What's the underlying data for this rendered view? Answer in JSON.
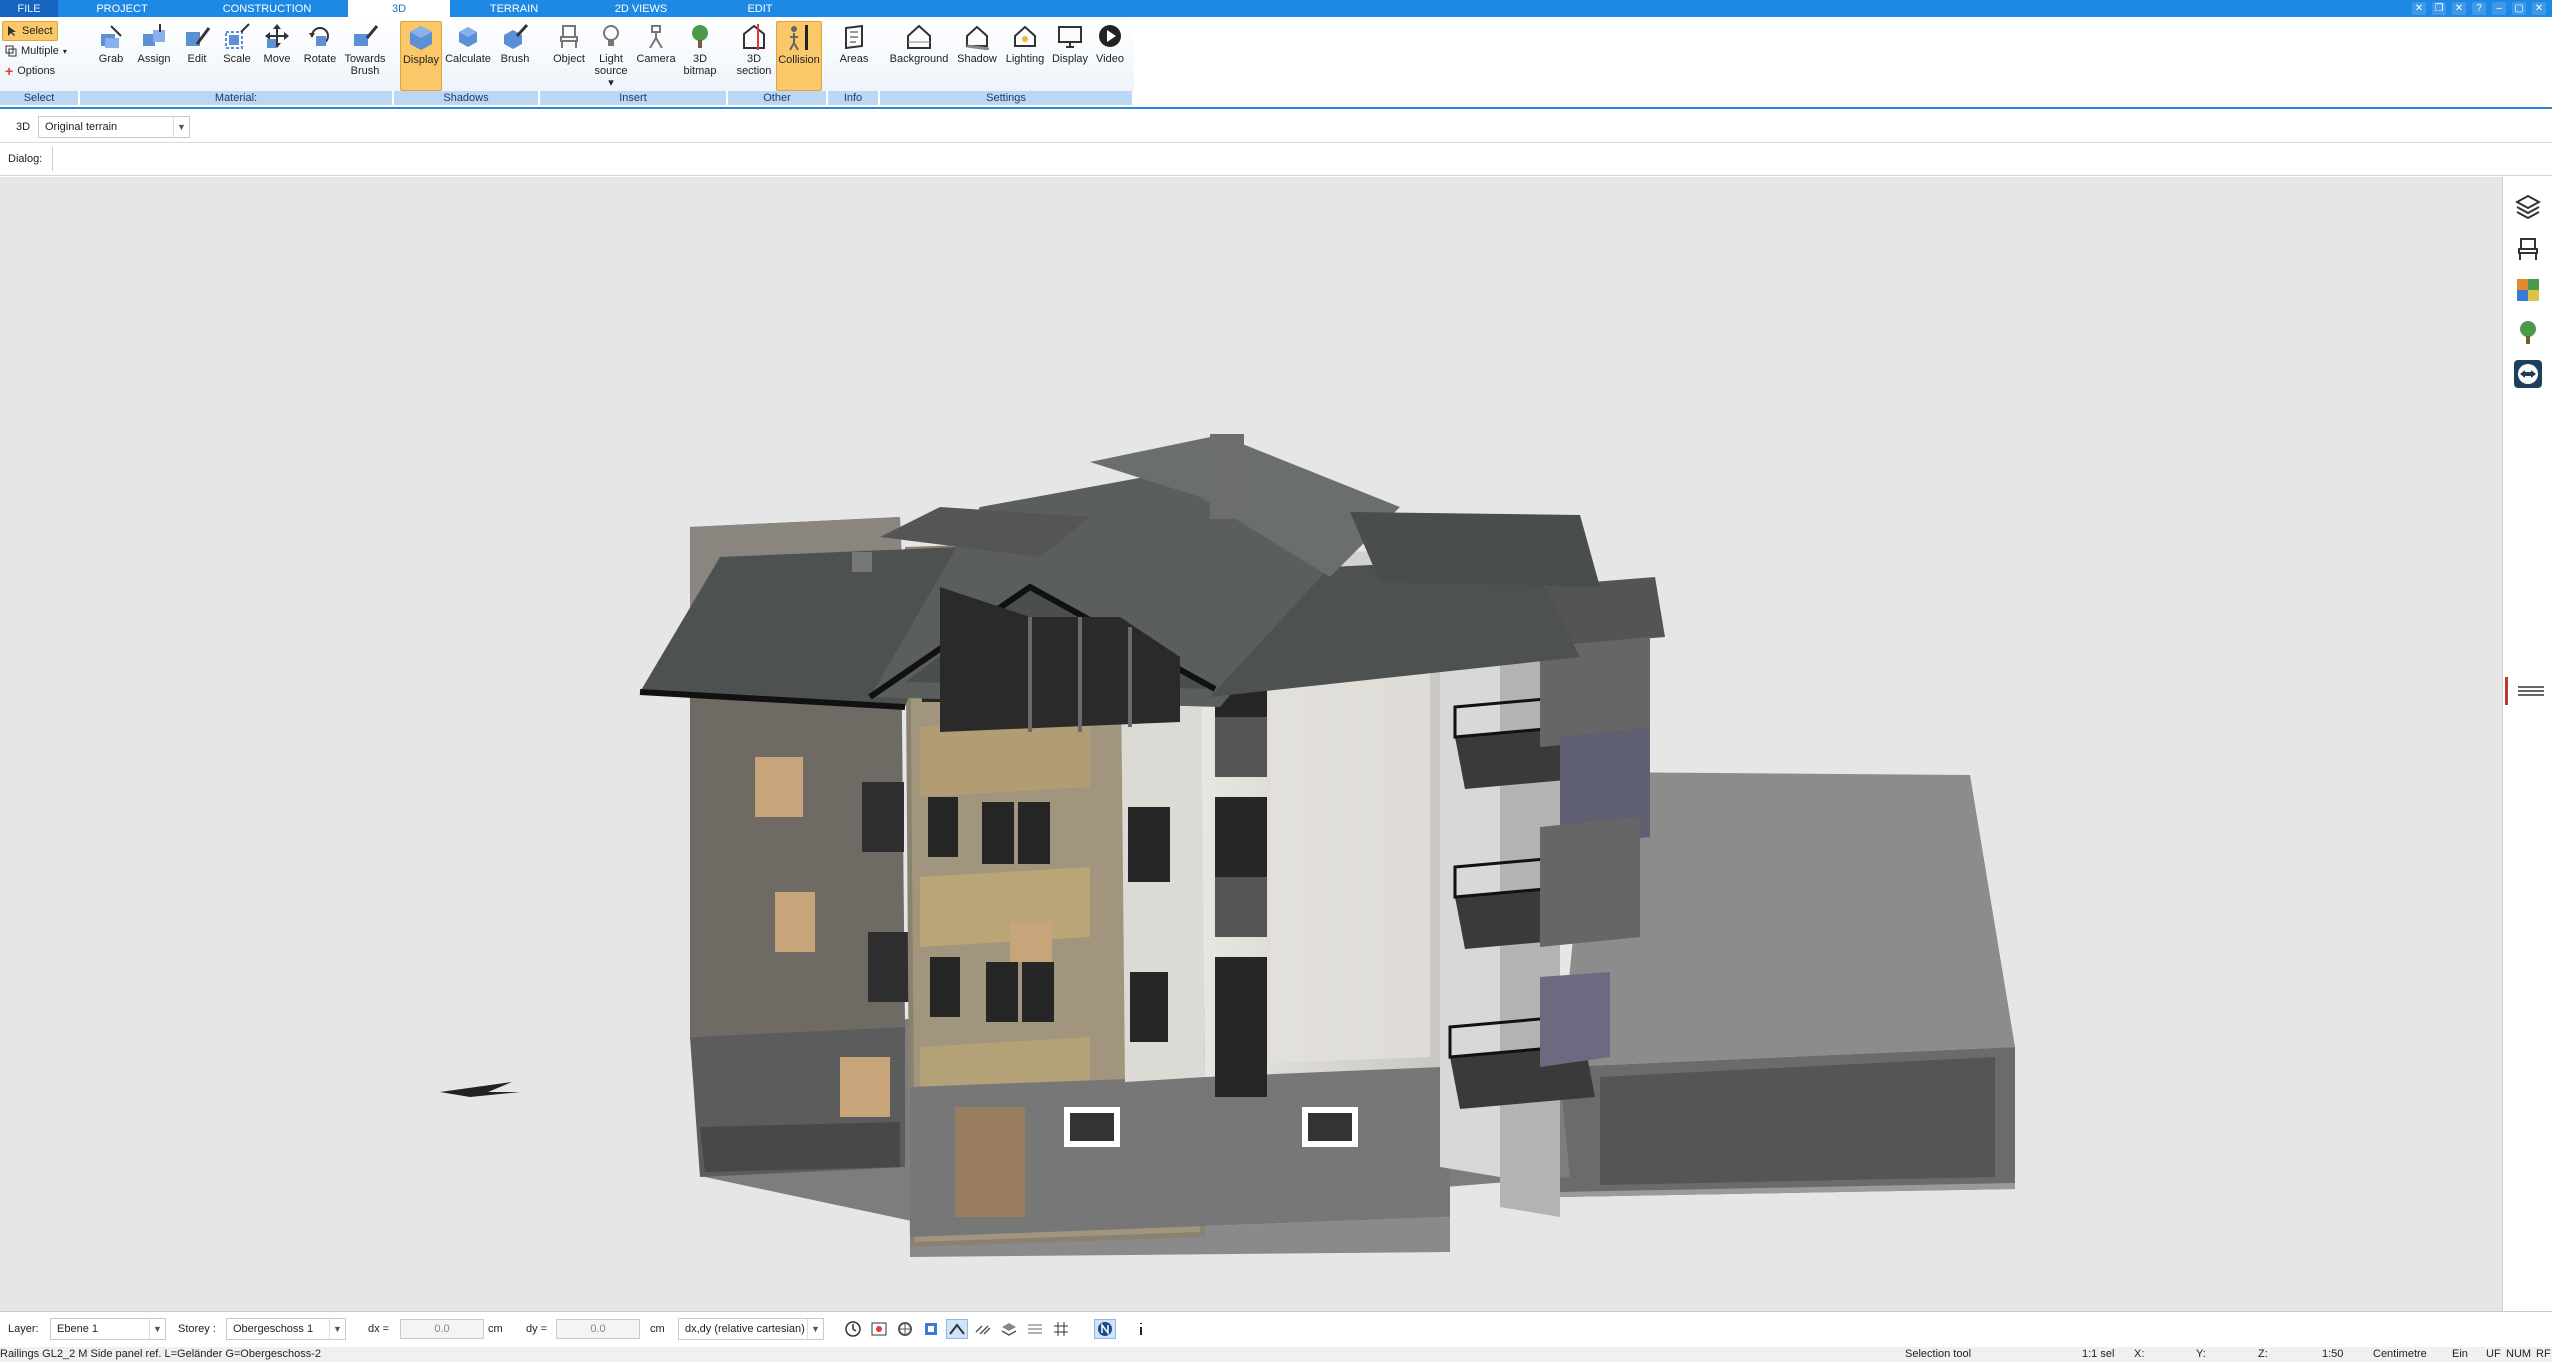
{
  "menu": {
    "tabs": [
      "FILE",
      "PROJECT",
      "CONSTRUCTION",
      "3D",
      "TERRAIN",
      "2D VIEWS",
      "EDIT"
    ],
    "active": "3D"
  },
  "ribbon": {
    "select_group": {
      "select": "Select",
      "multiple": "Multiple",
      "options": "Options"
    },
    "material": [
      {
        "label1": "Grab",
        "label2": ""
      },
      {
        "label1": "Assign",
        "label2": ""
      },
      {
        "label1": "Edit",
        "label2": ""
      },
      {
        "label1": "Scale",
        "label2": ""
      },
      {
        "label1": "Move",
        "label2": ""
      },
      {
        "label1": "Rotate",
        "label2": ""
      },
      {
        "label1": "Towards",
        "label2": "Brush"
      }
    ],
    "shadows": [
      {
        "label1": "Display",
        "label2": ""
      },
      {
        "label1": "Calculate",
        "label2": ""
      },
      {
        "label1": "Brush",
        "label2": ""
      }
    ],
    "insert": [
      {
        "label1": "Object",
        "label2": ""
      },
      {
        "label1": "Light",
        "label2": "source ▾"
      },
      {
        "label1": "Camera",
        "label2": ""
      },
      {
        "label1": "3D",
        "label2": "bitmap"
      }
    ],
    "other": [
      {
        "label1": "3D",
        "label2": "section"
      },
      {
        "label1": "Collision",
        "label2": ""
      }
    ],
    "info": [
      {
        "label1": "Areas",
        "label2": ""
      }
    ],
    "settings": [
      {
        "label1": "Background",
        "label2": ""
      },
      {
        "label1": "Shadow",
        "label2": ""
      },
      {
        "label1": "Lighting",
        "label2": ""
      },
      {
        "label1": "Display",
        "label2": ""
      },
      {
        "label1": "Video",
        "label2": ""
      }
    ],
    "groups": [
      "Select",
      "Material:",
      "Shadows",
      "Insert",
      "Other",
      "Info",
      "Settings"
    ]
  },
  "toolbar": {
    "mode_label": "3D",
    "terrain_select": "Original terrain",
    "dialog_label": "Dialog:"
  },
  "bottom": {
    "layer_label": "Layer:",
    "layer_value": "Ebene 1",
    "storey_label": "Storey :",
    "storey_value": "Obergeschoss 1",
    "dx_label": "dx =",
    "dx_value": "0.0",
    "dx_unit": "cm",
    "dy_label": "dy =",
    "dy_value": "0.0",
    "dy_unit": "cm",
    "coord_mode": "dx,dy (relative cartesian)"
  },
  "status": {
    "left": "Railings GL2_2 M Side panel ref. L=Geländer G=Obergeschoss-2",
    "tool": "Selection tool",
    "sel": "1:1 sel",
    "x": "X:",
    "y": "Y:",
    "z": "Z:",
    "scale": "1:50",
    "unit": "Centimetre",
    "ein": "Ein",
    "uf": "UF",
    "num": "NUM",
    "rf": "RF"
  },
  "colors": {
    "accent": "#1e88e5",
    "ribbon_group": "#bcd7f3",
    "selected": "#fbc869",
    "viewport_bg": "#e6e6e6"
  }
}
